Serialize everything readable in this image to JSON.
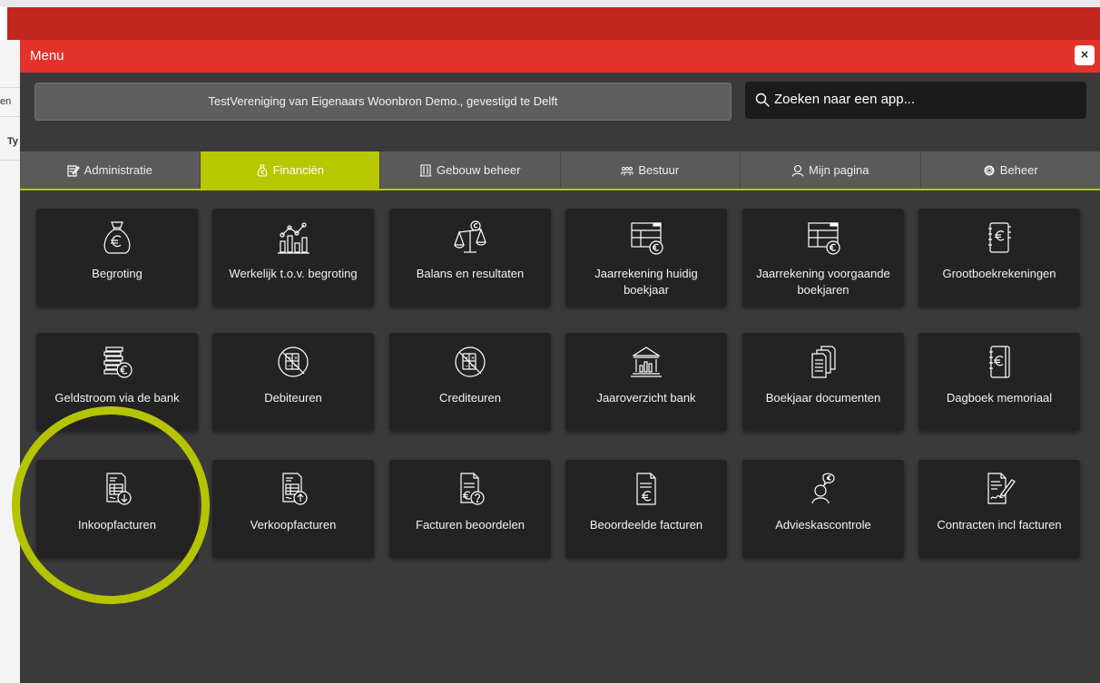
{
  "background": {
    "fragment_1": "en",
    "fragment_2": "Ty"
  },
  "modal": {
    "title": "Menu",
    "close_label": "×",
    "organization": "TestVereniging van Eigenaars Woonbron Demo., gevestigd te Delft",
    "search": {
      "placeholder": "Zoeken naar een app..."
    }
  },
  "tabs": [
    {
      "label": "Administratie",
      "icon": "edit-icon",
      "active": false
    },
    {
      "label": "Financiën",
      "icon": "money-bag-icon",
      "active": true
    },
    {
      "label": "Gebouw beheer",
      "icon": "building-icon",
      "active": false
    },
    {
      "label": "Bestuur",
      "icon": "people-icon",
      "active": false
    },
    {
      "label": "Mijn pagina",
      "icon": "user-icon",
      "active": false
    },
    {
      "label": "Beheer",
      "icon": "gear-icon",
      "active": false
    }
  ],
  "apps": [
    {
      "label": "Begroting",
      "icon": "money-bag-euro-icon"
    },
    {
      "label": "Werkelijk t.o.v. begroting",
      "icon": "bar-chart-trend-icon"
    },
    {
      "label": "Balans en resultaten",
      "icon": "balance-scale-icon"
    },
    {
      "label": "Jaarrekening huidig boekjaar",
      "icon": "spreadsheet-euro-icon"
    },
    {
      "label": "Jaarrekening voorgaande boekjaren",
      "icon": "spreadsheet-euro-icon"
    },
    {
      "label": "Grootboekrekeningen",
      "icon": "ledger-book-icon"
    },
    {
      "label": "Geldstroom via de bank",
      "icon": "coin-stack-icon"
    },
    {
      "label": "Debiteuren",
      "icon": "calculator-circle-icon"
    },
    {
      "label": "Crediteuren",
      "icon": "calculator-circle-icon"
    },
    {
      "label": "Jaaroverzicht bank",
      "icon": "bank-icon"
    },
    {
      "label": "Boekjaar documenten",
      "icon": "documents-icon"
    },
    {
      "label": "Dagboek memoriaal",
      "icon": "journal-book-icon"
    },
    {
      "label": "Inkoopfacturen",
      "icon": "invoice-download-icon"
    },
    {
      "label": "Verkoopfacturen",
      "icon": "invoice-upload-icon"
    },
    {
      "label": "Facturen beoordelen",
      "icon": "invoice-question-icon"
    },
    {
      "label": "Beoordeelde facturen",
      "icon": "invoice-euro-icon"
    },
    {
      "label": "Advieskascontrole",
      "icon": "advisor-icon"
    },
    {
      "label": "Contracten incl facturen",
      "icon": "contract-sign-icon"
    }
  ],
  "highlighted_app": "Inkoopfacturen",
  "colors": {
    "header_red": "#e2322b",
    "accent_green": "#b7c800",
    "modal_background": "#3a3a3a",
    "tile_background": "#232323"
  }
}
